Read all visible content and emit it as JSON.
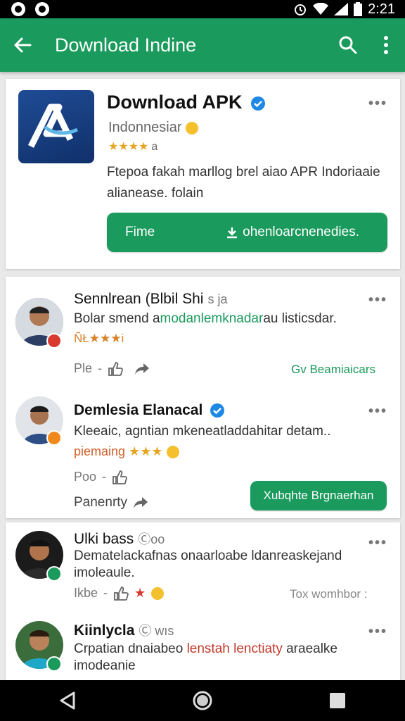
{
  "status_bar": {
    "time": "2:21"
  },
  "app_bar": {
    "title": "Download Indine"
  },
  "app": {
    "name": "Download APK",
    "developer": "Indonnesiar",
    "rating_stars": "★★★★",
    "rating_count": "a",
    "description": "Ftepoa fakah marllog brel aiao APR Indoriaaie alianease. folain",
    "button_left": "Fime",
    "button_right": "ohenloarcnenedies."
  },
  "reviews": [
    {
      "name": "Sennlrean (Blbil Shi",
      "handle": "s ja",
      "text_a": "Bolar smend a",
      "text_b": "modanlemknadar",
      "text_c": "au listicsdar.",
      "stars": "ÑŁ★★★i",
      "action_label": "Ple",
      "link": "Gv Beamiaicars"
    },
    {
      "name": "Demlesia Elanacal",
      "text": "Kleeaic, agntian mkeneatladdahitar detam..",
      "stars_label": "piemaing",
      "stars": "★★★",
      "action_label": "Poo",
      "secondary_label": "Panenrty",
      "button": "Xubqhte Brgnaerhan"
    },
    {
      "name": "Ulki bass",
      "handle": "Ⓒoo",
      "text": "Dematelackafnas onaarloabe ldanreaskejand imoleaule.",
      "action_label": "Ikbe",
      "muted_link": "Tox womhbor :"
    },
    {
      "name": "Kiinlycla",
      "handle": "Ⓒ wıs",
      "text_a": "Crpatian dnaiabeo ",
      "text_b": "lenstah lenctiaty",
      "text_c": " araealke imodeanie"
    }
  ],
  "colors": {
    "primary": "#1a9a5c",
    "star": "#e5a422",
    "verified": "#1e88e5"
  }
}
